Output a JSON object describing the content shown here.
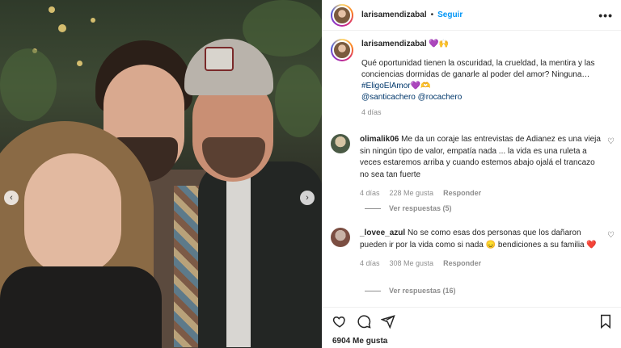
{
  "post": {
    "username": "larisamendizabal",
    "follow_label": "Seguir",
    "more_label": "•••"
  },
  "caption": {
    "username": "larisamendizabal",
    "emoji": "💜🙌",
    "text": "Qué oportunidad tienen la oscuridad, la crueldad, la mentira y las conciencias dormidas de ganarle al poder del amor? Ninguna…",
    "hashtag": "#EligoElAmor💜🫶",
    "mention1": "@santicachero",
    "mention2": "@rocachero",
    "time": "4 días"
  },
  "comments": [
    {
      "username": "olimalik06",
      "text": "Me da un coraje las entrevistas de Adianez es una vieja sin ningún tipo de valor, empatía nada ... la vida es una ruleta a veces estaremos arriba y cuando estemos abajo ojalá el trancazo no sea tan fuerte",
      "time": "4 días",
      "likes": "228 Me gusta",
      "reply_label": "Responder",
      "view_replies": "Ver respuestas (5)"
    },
    {
      "username": "_lovee_azul",
      "text": "No se como esas dos personas que los dañaron pueden ir por la vida como si nada 😞 bendiciones a su familia ❤️",
      "time": "4 días",
      "likes": "308 Me gusta",
      "reply_label": "Responder",
      "view_replies": "Ver respuestas (16)"
    }
  ],
  "footer": {
    "likes": "6904 Me gusta"
  },
  "colors": {
    "link": "#0095f6",
    "secondary_text": "#8e8e8e",
    "primary_text": "#262626"
  }
}
